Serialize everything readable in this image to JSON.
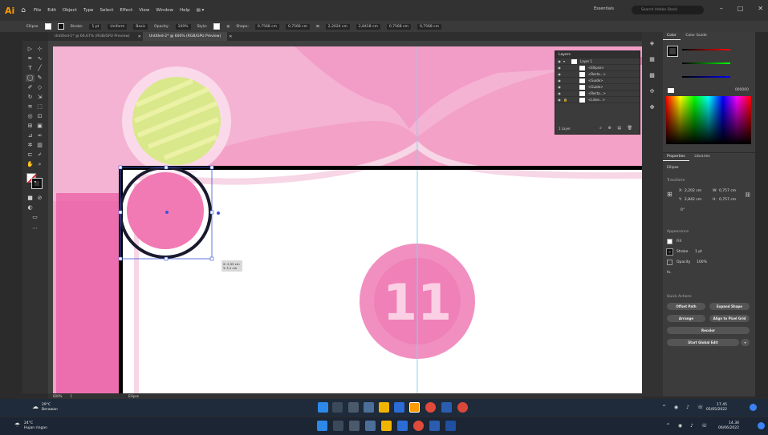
{
  "app": {
    "logo": "Ai",
    "home_icon": "home-icon"
  },
  "menu": [
    "File",
    "Edit",
    "Object",
    "Type",
    "Select",
    "Effect",
    "View",
    "Window",
    "Help"
  ],
  "workspace": "Essentials",
  "search": {
    "placeholder": "Search Adobe Stock"
  },
  "control_bar": {
    "object_label": "Ellipse",
    "stroke_label": "Stroke:",
    "stroke_value": "1 pt",
    "profile": "Uniform",
    "brush": "Basic",
    "opacity_label": "Opacity:",
    "opacity_value": "100%",
    "style_label": "Style:",
    "shape_label": "Shape:",
    "w_value": "0,7568 cm",
    "h_value": "0,7568 cm",
    "x_value": "2,2024 cm",
    "y_value": "2,8418 cm",
    "w2_value": "0,7568 cm",
    "h2_value": "0,7568 cm"
  },
  "tabs": [
    {
      "label": "Untitled-1* @ 66,67% (RGB/GPU Preview)"
    },
    {
      "label": "Untitled-2* @ 600% (RGB/GPU Preview)"
    }
  ],
  "tooltip": {
    "line1": "X: 2,55 cm",
    "line2": "Y: 3,1 cm"
  },
  "canvas_badge": "11",
  "status": {
    "zoom": "600%",
    "page": "1",
    "tool": "Ellipse"
  },
  "layers": {
    "title": "Layers",
    "rows": [
      {
        "label": "Layer 1"
      },
      {
        "label": "<Ellipse>"
      },
      {
        "label": "<Recta...>"
      },
      {
        "label": "<Guide>"
      },
      {
        "label": "<Guide>"
      },
      {
        "label": "<Recta...>"
      },
      {
        "label": "<Linke...>"
      }
    ],
    "footer": "1 Layer"
  },
  "color_panel": {
    "tab1": "Color",
    "tab2": "Color Guide",
    "hex": "000000"
  },
  "properties": {
    "tab1": "Properties",
    "tab2": "Libraries",
    "object": "Ellipse",
    "transform_title": "Transform",
    "x_label": "X:",
    "x_value": "2,202 cm",
    "y_label": "Y:",
    "y_value": "2,842 cm",
    "w_label": "W:",
    "w_value": "0,757 cm",
    "h_label": "H:",
    "h_value": "0,757 cm",
    "angle": "0°",
    "appearance_title": "Appearance",
    "fill_label": "Fill",
    "stroke_label": "Stroke",
    "stroke_value": "1 pt",
    "opacity_label": "Opacity",
    "opacity_value": "100%",
    "fx": "fx.",
    "quick_title": "Quick Actions",
    "offset_path": "Offset Path",
    "expand_shape": "Expand Shape",
    "arrange": "Arrange",
    "align_pixel": "Align to Pixel Grid",
    "recolor": "Recolor",
    "global_edit": "Start Global Edit"
  },
  "taskbar1": {
    "temp": "29°C",
    "cond": "Berawan",
    "time": "17.45",
    "date": "05/05/2022"
  },
  "taskbar2": {
    "temp": "24°C",
    "cond": "Hujan ringan",
    "time": "14.30",
    "date": "06/06/2022"
  },
  "colors": {
    "accent": "#ff9a00",
    "canvas_pink": "#f3a1c7",
    "selection": "#3a56d6"
  }
}
